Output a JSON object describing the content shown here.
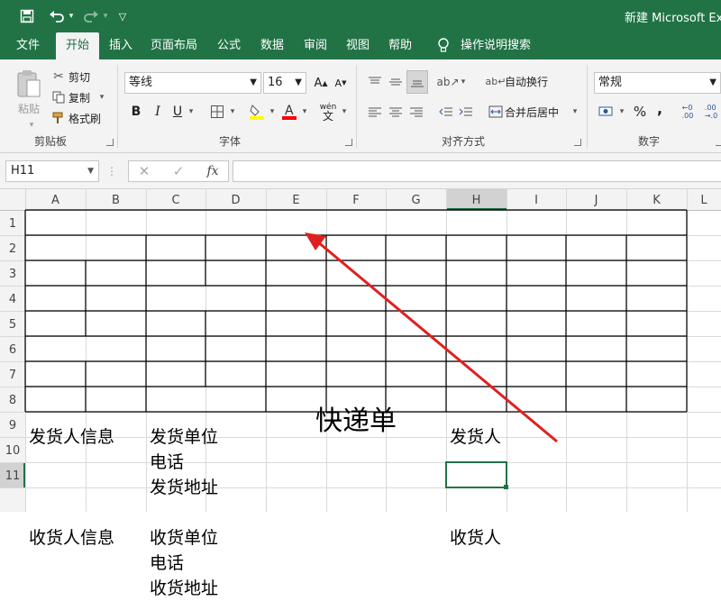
{
  "title_bar": {
    "doc_title": "新建 Microsoft Ex",
    "customize_glyph": "▽"
  },
  "tabs": [
    "文件",
    "开始",
    "插入",
    "页面布局",
    "公式",
    "数据",
    "审阅",
    "视图",
    "帮助",
    "操作说明搜索"
  ],
  "active_tab": "开始",
  "ribbon": {
    "clipboard": {
      "paste": "粘贴",
      "cut": "剪切",
      "copy": "复制",
      "format_painter": "格式刷",
      "label": "剪贴板"
    },
    "font": {
      "font_name": "等线",
      "font_size": "16",
      "bold": "B",
      "italic": "I",
      "underline": "U",
      "phonetic": "wén",
      "label": "字体",
      "fill_color": "#ffff00",
      "font_color": "#ff0000"
    },
    "alignment": {
      "wrap_text": "自动换行",
      "merge_center": "合并后居中",
      "label": "对齐方式"
    },
    "number": {
      "format": "常规",
      "percent": "%",
      "comma": ",",
      "label": "数字"
    }
  },
  "formula_bar": {
    "name_box": "H11",
    "fx": "fx",
    "formula": ""
  },
  "columns": [
    "A",
    "B",
    "C",
    "D",
    "E",
    "F",
    "G",
    "H",
    "I",
    "J",
    "K",
    "L"
  ],
  "rows": [
    "1",
    "2",
    "3",
    "4",
    "5",
    "6",
    "7",
    "8",
    "9",
    "10",
    "11"
  ],
  "selected_cell": "H11",
  "cells": {
    "A1": "快递单",
    "A2": "发货人信息",
    "C2": "发货单位",
    "H2": "发货人",
    "C3": "电话",
    "C4": "发货地址",
    "A6": "收货人信息",
    "C6": "收货单位",
    "H6": "收货人",
    "C7": "电话",
    "C8": "收货地址"
  },
  "colors": {
    "excel_green": "#217346",
    "annotation_arrow": "#e02020",
    "selection": "#217346"
  }
}
